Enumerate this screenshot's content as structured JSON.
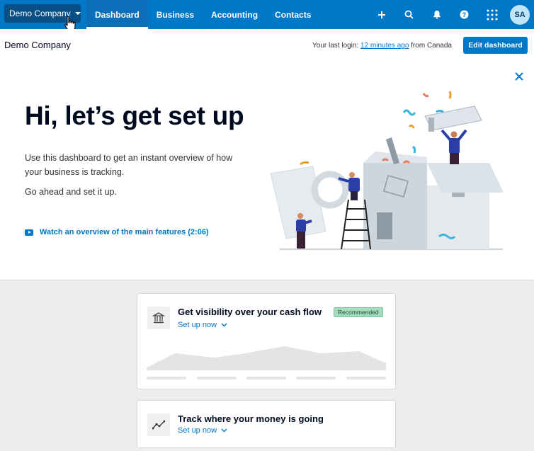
{
  "nav": {
    "org_name": "Demo Company",
    "tabs": [
      {
        "label": "Dashboard",
        "active": true
      },
      {
        "label": "Business",
        "active": false
      },
      {
        "label": "Accounting",
        "active": false
      },
      {
        "label": "Contacts",
        "active": false
      }
    ],
    "icons": [
      "plus-icon",
      "search-icon",
      "bell-icon",
      "help-icon",
      "apps-grid-icon"
    ],
    "avatar_initials": "SA"
  },
  "subheader": {
    "title": "Demo Company",
    "login_prefix": "Your last login:",
    "login_time": "12 minutes ago",
    "login_suffix": "from Canada",
    "edit_button": "Edit dashboard"
  },
  "hero": {
    "title": "Hi, let’s get set up",
    "text1": "Use this dashboard to get an instant overview of how your business is tracking.",
    "text2": "Go ahead and set it up.",
    "video_link": "Watch an overview of the main features (2:06)"
  },
  "cards": [
    {
      "title": "Get visibility over your cash flow",
      "setup": "Set up now",
      "badge": "Recommended",
      "icon": "bank-icon"
    },
    {
      "title": "Track where your money is going",
      "setup": "Set up now",
      "icon": "trend-line-icon"
    }
  ],
  "colors": {
    "brand": "#0078c8",
    "nav_dark": "#0a4f86",
    "badge": "#a6dcbe"
  }
}
